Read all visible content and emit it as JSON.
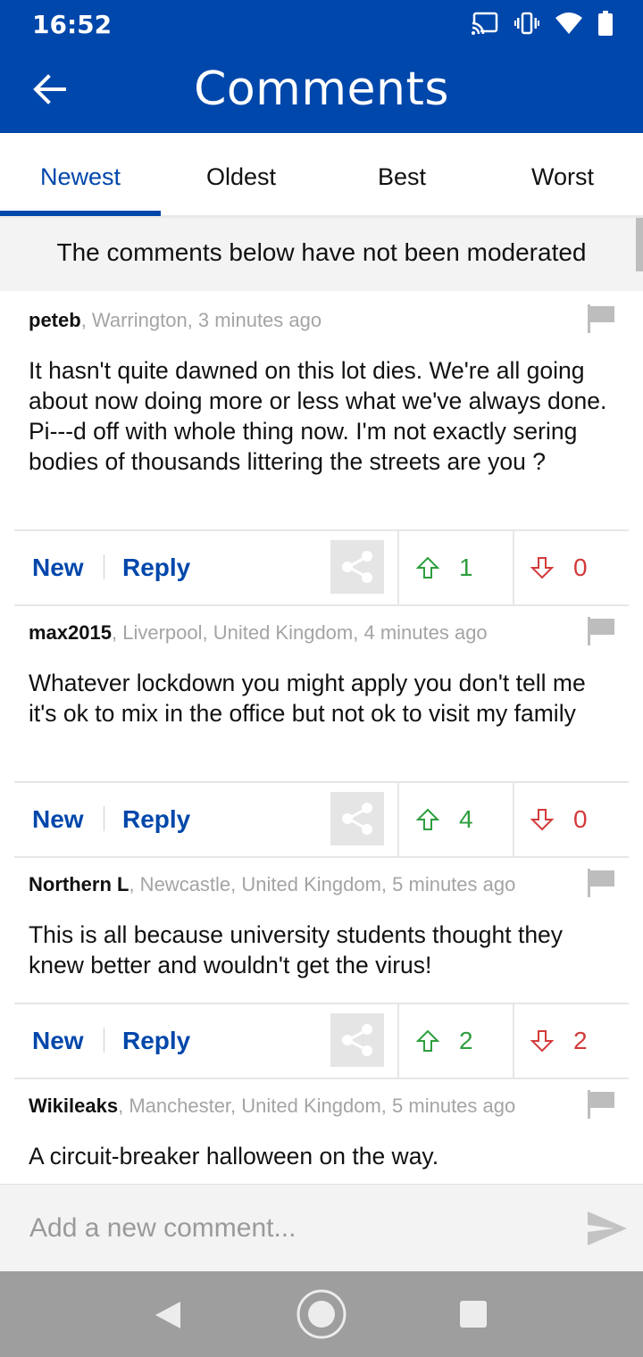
{
  "status_bar": {
    "time": "16:52",
    "icons": [
      "cast-icon",
      "vibrate-icon",
      "wifi-icon",
      "battery-icon"
    ]
  },
  "app_bar": {
    "title": "Comments",
    "back_icon": "arrow-back-icon"
  },
  "tabs": [
    {
      "label": "Newest",
      "active": true
    },
    {
      "label": "Oldest",
      "active": false
    },
    {
      "label": "Best",
      "active": false
    },
    {
      "label": "Worst",
      "active": false
    }
  ],
  "notice": "The comments below have not been moderated",
  "comments": [
    {
      "user": "peteb",
      "meta": ", Warrington, 3 minutes ago",
      "body": "It hasn't quite dawned on this lot dies. We're all going about now doing more or less what we've always done. Pi---d off with whole thing now. I'm not exactly sering bodies of thousands littering the streets are you ?",
      "new_label": "New",
      "reply_label": "Reply",
      "up_votes": "1",
      "down_votes": "0"
    },
    {
      "user": "max2015",
      "meta": ", Liverpool, United Kingdom, 4 minutes ago",
      "body": "Whatever lockdown you might apply you don't tell me it's ok to mix in the office but not ok to visit my family",
      "new_label": "New",
      "reply_label": "Reply",
      "up_votes": "4",
      "down_votes": "0"
    },
    {
      "user": "Northern L",
      "meta": ", Newcastle, United Kingdom, 5 minutes ago",
      "body": "This is all because university students thought they knew better and wouldn't get the virus!",
      "new_label": "New",
      "reply_label": "Reply",
      "up_votes": "2",
      "down_votes": "2"
    },
    {
      "user": "Wikileaks",
      "meta": ", Manchester, United Kingdom, 5 minutes ago",
      "body": "A circuit-breaker halloween on the way."
    }
  ],
  "composer": {
    "placeholder": "Add a new comment...",
    "send_icon": "send-icon"
  },
  "nav_bar": {
    "icons": [
      "nav-back-icon",
      "nav-home-icon",
      "nav-recents-icon"
    ]
  },
  "colors": {
    "brand": "#0047AB",
    "upvote": "#2e9e3e",
    "downvote": "#d33a3a"
  }
}
